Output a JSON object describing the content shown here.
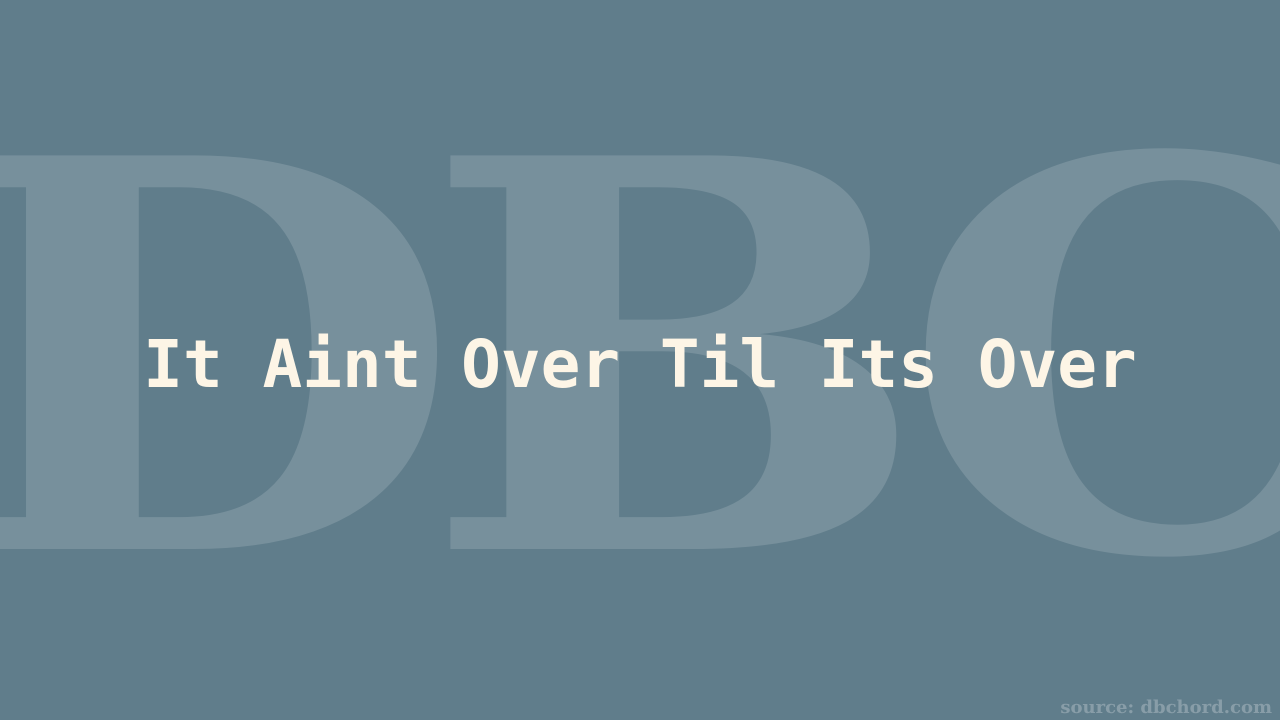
{
  "watermark": {
    "text": "DBC"
  },
  "title": "It Aint Over Til Its Over",
  "source": "source: dbchord.com",
  "colors": {
    "background": "#607d8b",
    "title_text": "#fdf5e6"
  }
}
